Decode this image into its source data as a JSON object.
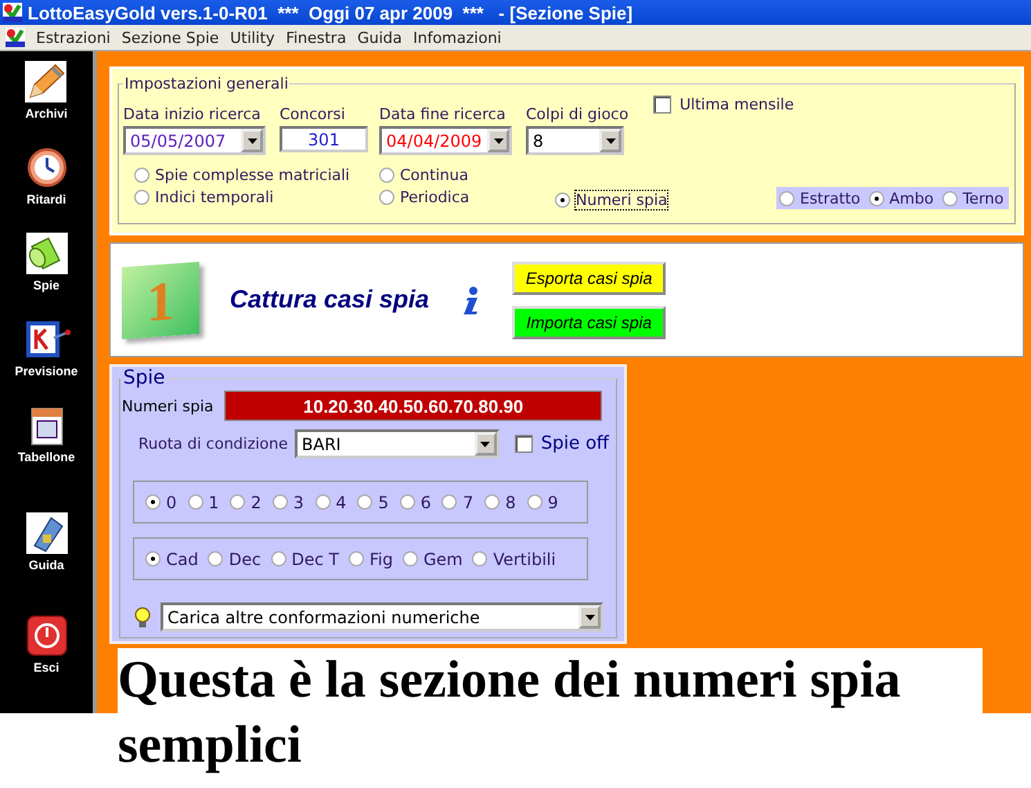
{
  "window": {
    "title": "LottoEasyGold vers.1-0-R01  ***  Oggi 07 apr 2009  ***   - [Sezione Spie]"
  },
  "menu": [
    "Estrazioni",
    "Sezione Spie",
    "Utility",
    "Finestra",
    "Guida",
    "Infomazioni"
  ],
  "sidebar": {
    "items": [
      {
        "kind": "pencil",
        "label": "Archivi"
      },
      {
        "kind": "clock",
        "label": "Ritardi"
      },
      {
        "kind": "flashlight",
        "label": "Spie"
      },
      {
        "kind": "board",
        "label": "Previsione"
      },
      {
        "kind": "calendar",
        "label": "Tabellone"
      },
      {
        "kind": "book",
        "label": "Guida"
      },
      {
        "kind": "power",
        "label": "Esci"
      }
    ]
  },
  "settings": {
    "title": "Impostazioni generali",
    "start_date": {
      "label": "Data inizio ricerca",
      "value": "05/05/2007"
    },
    "draws": {
      "label": "Concorsi",
      "value": "301"
    },
    "end_date": {
      "label": "Data fine ricerca",
      "value": "04/04/2009"
    },
    "plays": {
      "label": "Colpi di gioco",
      "value": "8"
    },
    "last_monthly": {
      "label": "Ultima mensile",
      "checked": false
    },
    "modes": [
      {
        "label": "Spie complesse matriciali",
        "selected": false
      },
      {
        "label": "Indici temporali",
        "selected": false
      },
      {
        "label": "Continua",
        "selected": false
      },
      {
        "label": "Periodica",
        "selected": false
      },
      {
        "label": "Numeri spia",
        "selected": true
      }
    ],
    "bets": [
      {
        "label": "Estratto",
        "selected": false
      },
      {
        "label": "Ambo",
        "selected": true
      },
      {
        "label": "Terno",
        "selected": false
      }
    ]
  },
  "banner": {
    "badge": "1",
    "title": "Cattura casi spia",
    "buttons": [
      {
        "kind": "export",
        "label": "Esporta casi spia"
      },
      {
        "kind": "import",
        "label": "Importa casi spia"
      }
    ]
  },
  "spie": {
    "title": "Spie",
    "numbers": {
      "label": "Numeri spia",
      "value": "10.20.30.40.50.60.70.80.90"
    },
    "wheel": {
      "label": "Ruota di condizione",
      "value": "BARI"
    },
    "spie_off": {
      "label": "Spie off",
      "checked": false
    },
    "digits": [
      {
        "label": "0",
        "selected": true
      },
      {
        "label": "1",
        "selected": false
      },
      {
        "label": "2",
        "selected": false
      },
      {
        "label": "3",
        "selected": false
      },
      {
        "label": "4",
        "selected": false
      },
      {
        "label": "5",
        "selected": false
      },
      {
        "label": "6",
        "selected": false
      },
      {
        "label": "7",
        "selected": false
      },
      {
        "label": "8",
        "selected": false
      },
      {
        "label": "9",
        "selected": false
      }
    ],
    "types": [
      {
        "label": "Cad",
        "selected": true
      },
      {
        "label": "Dec",
        "selected": false
      },
      {
        "label": "Dec T",
        "selected": false
      },
      {
        "label": "Fig",
        "selected": false
      },
      {
        "label": "Gem",
        "selected": false
      },
      {
        "label": "Vertibili",
        "selected": false
      }
    ],
    "conformations": {
      "value": "Carica altre conformazioni numeriche"
    }
  },
  "caption": "Questa è la sezione dei numeri spia semplici"
}
